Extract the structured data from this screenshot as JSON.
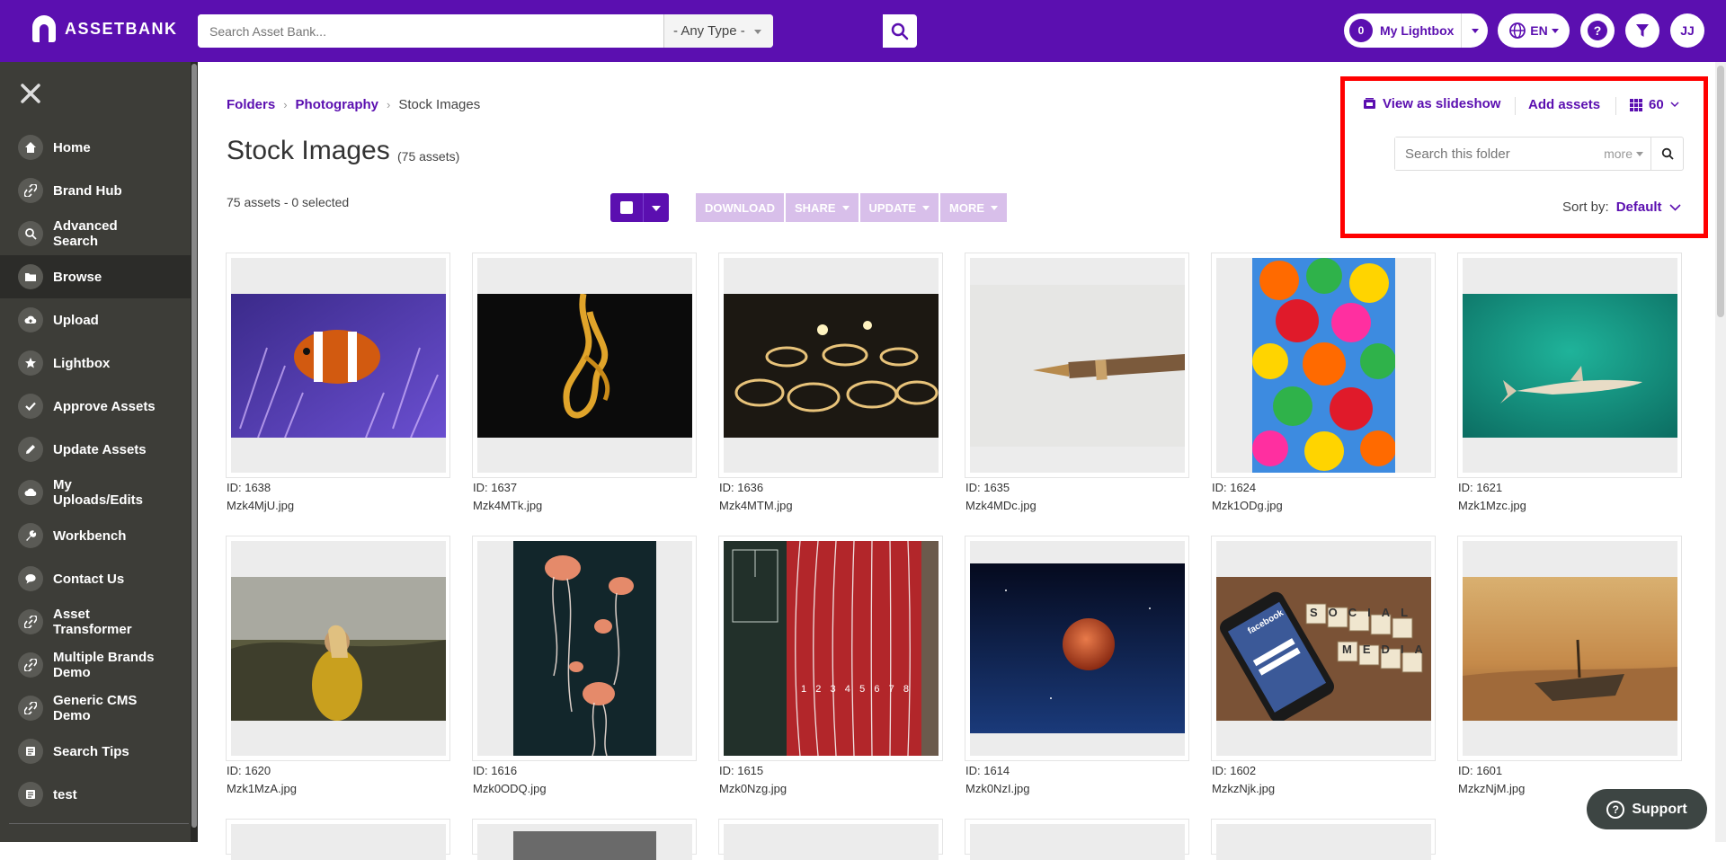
{
  "app": {
    "logo_text": "ASSETBANK"
  },
  "header": {
    "search_placeholder": "Search Asset Bank...",
    "type_select": "- Any Type -",
    "lightbox_count": "0",
    "lightbox_label": "My Lightbox",
    "language": "EN",
    "help": "?",
    "user_initials": "JJ"
  },
  "sidebar": {
    "items": [
      {
        "label": "Home",
        "icon": "home-icon"
      },
      {
        "label": "Brand Hub",
        "icon": "link-icon"
      },
      {
        "label": "Advanced Search",
        "icon": "search-icon"
      },
      {
        "label": "Browse",
        "icon": "folder-icon"
      },
      {
        "label": "Upload",
        "icon": "upload-icon"
      },
      {
        "label": "Lightbox",
        "icon": "star-icon"
      },
      {
        "label": "Approve Assets",
        "icon": "check-icon"
      },
      {
        "label": "Update Assets",
        "icon": "pencil-icon"
      },
      {
        "label": "My Uploads/Edits",
        "icon": "cloud-icon"
      },
      {
        "label": "Workbench",
        "icon": "wrench-icon"
      },
      {
        "label": "Contact Us",
        "icon": "chat-icon"
      },
      {
        "label": "Asset Transformer",
        "icon": "link-icon"
      },
      {
        "label": "Multiple Brands Demo",
        "icon": "link-icon"
      },
      {
        "label": "Generic CMS Demo",
        "icon": "link-icon"
      },
      {
        "label": "Search Tips",
        "icon": "list-icon"
      },
      {
        "label": "test",
        "icon": "list-icon"
      }
    ],
    "active": "Browse"
  },
  "breadcrumb": {
    "items": [
      "Folders",
      "Photography"
    ],
    "current": "Stock Images"
  },
  "page": {
    "title": "Stock Images",
    "asset_count": "(75 assets)",
    "selection_info": "75 assets -  0 selected"
  },
  "actions": [
    "DOWNLOAD",
    "SHARE",
    "UPDATE",
    "MORE"
  ],
  "toolbar": {
    "slideshow": "View as slideshow",
    "add_assets": "Add assets",
    "per_page": "60",
    "folder_search_placeholder": "Search this folder",
    "more": "more",
    "sort_label": "Sort by:",
    "sort_value": "Default"
  },
  "assets": [
    {
      "id": "ID: 1638",
      "file": "Mzk4MjU.jpg"
    },
    {
      "id": "ID: 1637",
      "file": "Mzk4MTk.jpg"
    },
    {
      "id": "ID: 1636",
      "file": "Mzk4MTM.jpg"
    },
    {
      "id": "ID: 1635",
      "file": "Mzk4MDc.jpg"
    },
    {
      "id": "ID: 1624",
      "file": "Mzk1ODg.jpg"
    },
    {
      "id": "ID: 1621",
      "file": "Mzk1Mzc.jpg"
    },
    {
      "id": "ID: 1620",
      "file": "Mzk1MzA.jpg"
    },
    {
      "id": "ID: 1616",
      "file": "Mzk0ODQ.jpg"
    },
    {
      "id": "ID: 1615",
      "file": "Mzk0Nzg.jpg"
    },
    {
      "id": "ID: 1614",
      "file": "Mzk0NzI.jpg"
    },
    {
      "id": "ID: 1602",
      "file": "MzkzNjk.jpg"
    },
    {
      "id": "ID: 1601",
      "file": "MzkzNjM.jpg"
    }
  ],
  "photo_text": {
    "social": "SOCIAL",
    "media": "MEDIA",
    "facebook": "facebook",
    "lanes": [
      "1",
      "2",
      "3",
      "4",
      "5",
      "6",
      "7",
      "8"
    ]
  },
  "support": {
    "label": "Support"
  },
  "colors": {
    "brand": "#5b0fb0",
    "sidebar": "#3d3d38",
    "highlight": "#ff0000"
  }
}
